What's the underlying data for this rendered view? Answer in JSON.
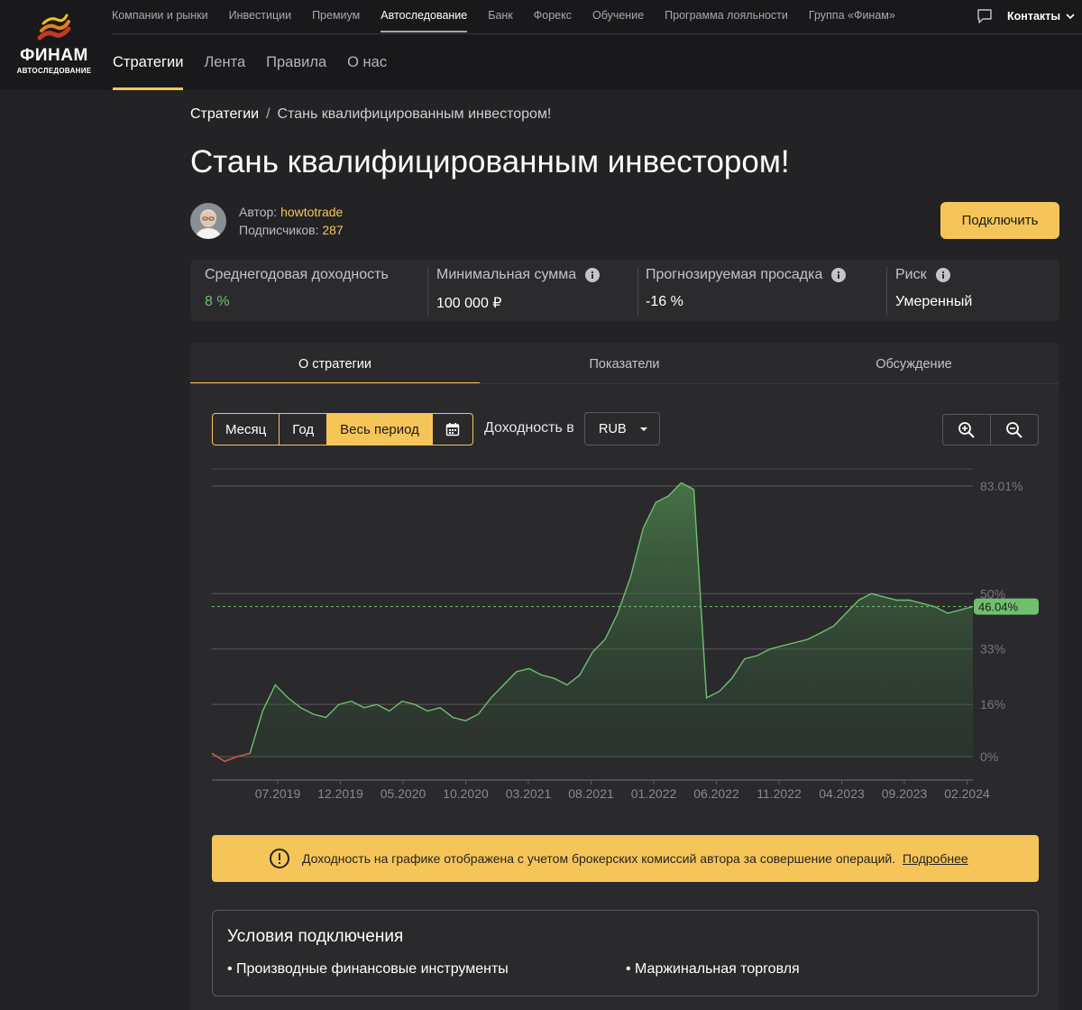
{
  "header": {
    "logo": {
      "title": "ФИНАМ",
      "subtitle": "АВТОСЛЕДОВАНИЕ"
    },
    "top_nav": [
      {
        "label": "Компании и рынки"
      },
      {
        "label": "Инвестиции"
      },
      {
        "label": "Премиум"
      },
      {
        "label": "Автоследование",
        "active": true
      },
      {
        "label": "Банк"
      },
      {
        "label": "Форекс"
      },
      {
        "label": "Обучение"
      },
      {
        "label": "Программа лояльности"
      },
      {
        "label": "Группа «Финам»"
      }
    ],
    "contacts_label": "Контакты",
    "sub_nav": [
      {
        "label": "Стратегии",
        "active": true
      },
      {
        "label": "Лента"
      },
      {
        "label": "Правила"
      },
      {
        "label": "О нас"
      }
    ]
  },
  "breadcrumb": {
    "root": "Стратегии",
    "separator": "/",
    "current": "Стань квалифицированным инвестором!"
  },
  "title": "Стань квалифицированным инвестором!",
  "author": {
    "author_label": "Автор:",
    "author_name": "howtotrade",
    "subscribers_label": "Подписчиков:",
    "subscribers_count": "287"
  },
  "connect_button": "Подключить",
  "stats": [
    {
      "label": "Среднегодовая доходность",
      "value": "8 %",
      "info": false
    },
    {
      "label": "Минимальная сумма",
      "value": "100 000 ₽",
      "info": true
    },
    {
      "label": "Прогнозируемая просадка",
      "value": "-16 %",
      "info": true
    },
    {
      "label": "Риск",
      "value": "Умеренный",
      "info": true
    }
  ],
  "tabs": [
    {
      "label": "О стратегии",
      "active": true
    },
    {
      "label": "Показатели"
    },
    {
      "label": "Обсуждение"
    }
  ],
  "range": {
    "month": "Месяц",
    "year": "Год",
    "all": "Весь период",
    "active": "all"
  },
  "yield_label": "Доходность в",
  "currency": "RUB",
  "colors": {
    "accent": "#f6c55a",
    "positive": "#6fbf6f",
    "negative": "#e04a4a"
  },
  "chart_data": {
    "type": "area",
    "x_ticks": [
      "07.2019",
      "12.2019",
      "05.2020",
      "10.2020",
      "03.2021",
      "08.2021",
      "01.2022",
      "06.2022",
      "11.2022",
      "04.2023",
      "09.2023",
      "02.2024"
    ],
    "y_ticks": [
      "83.01%",
      "50%",
      "33%",
      "16%",
      "0%"
    ],
    "y_tick_values": [
      83.01,
      50,
      33,
      16,
      0
    ],
    "ylim": [
      -4,
      88
    ],
    "current_value": "46.04%",
    "series": [
      {
        "x": [
          "2019-02",
          "2019-03",
          "2019-04",
          "2019-05",
          "2019-06",
          "2019-07",
          "2019-08",
          "2019-09",
          "2019-10",
          "2019-11",
          "2019-12",
          "2020-01",
          "2020-02",
          "2020-03",
          "2020-04",
          "2020-05",
          "2020-06",
          "2020-07",
          "2020-08",
          "2020-09",
          "2020-10",
          "2020-11",
          "2020-12",
          "2021-01",
          "2021-02",
          "2021-03",
          "2021-04",
          "2021-05",
          "2021-06",
          "2021-07",
          "2021-08",
          "2021-09",
          "2021-10",
          "2021-11",
          "2021-12",
          "2022-01",
          "2022-02",
          "2022-03",
          "2022-04",
          "2022-05",
          "2022-06",
          "2022-07",
          "2022-08",
          "2022-09",
          "2022-10",
          "2022-11",
          "2022-12",
          "2023-01",
          "2023-02",
          "2023-03",
          "2023-04",
          "2023-05",
          "2023-06",
          "2023-07",
          "2023-08",
          "2023-09",
          "2023-10",
          "2023-11",
          "2023-12",
          "2024-01",
          "2024-02"
        ],
        "y": [
          1,
          -1.5,
          0,
          1,
          14,
          22,
          18,
          15,
          13,
          12,
          16,
          17,
          15,
          16,
          14,
          17,
          16,
          14,
          15,
          12,
          11,
          13,
          18,
          22,
          26,
          27,
          25,
          24,
          22,
          25,
          32,
          36,
          44,
          55,
          70,
          78,
          80,
          84,
          82,
          18,
          20,
          24,
          30,
          31,
          33,
          34,
          35,
          36,
          38,
          40,
          44,
          48,
          50,
          49,
          48,
          48,
          47,
          46,
          44,
          45,
          46.04
        ]
      }
    ]
  },
  "notice": {
    "text": "Доходность на графике отображена с учетом брокерских комиссий автора за совершение операций.",
    "link": "Подробнее"
  },
  "conditions": {
    "title": "Условия подключения",
    "items": [
      "Производные финансовые инструменты",
      "Маржинальная торговля"
    ]
  }
}
